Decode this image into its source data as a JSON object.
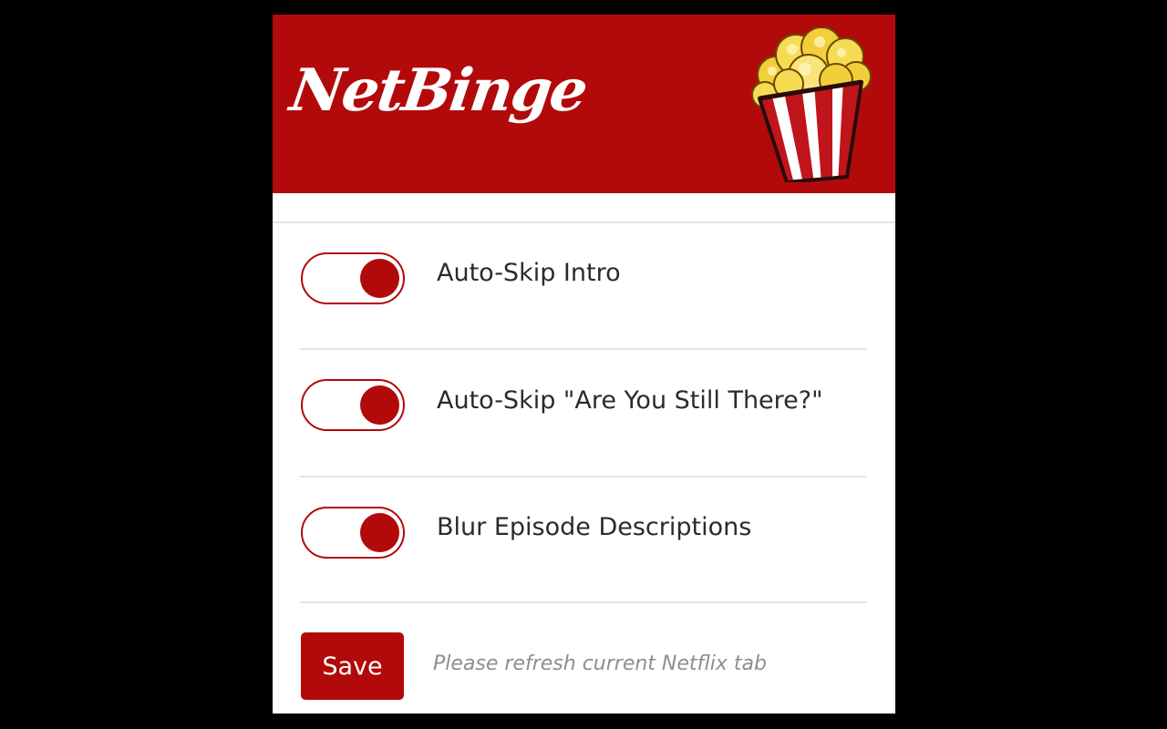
{
  "app": {
    "logo_text": "NetBinge",
    "brand_color": "#b20a0a",
    "logo_icon": "popcorn-icon"
  },
  "options": [
    {
      "label": "Auto-Skip Intro",
      "enabled": true
    },
    {
      "label": "Auto-Skip \"Are You Still There?\"",
      "enabled": true
    },
    {
      "label": "Blur Episode Descriptions",
      "enabled": true
    }
  ],
  "footer": {
    "save_label": "Save",
    "note": "Please refresh current Netflix tab"
  }
}
